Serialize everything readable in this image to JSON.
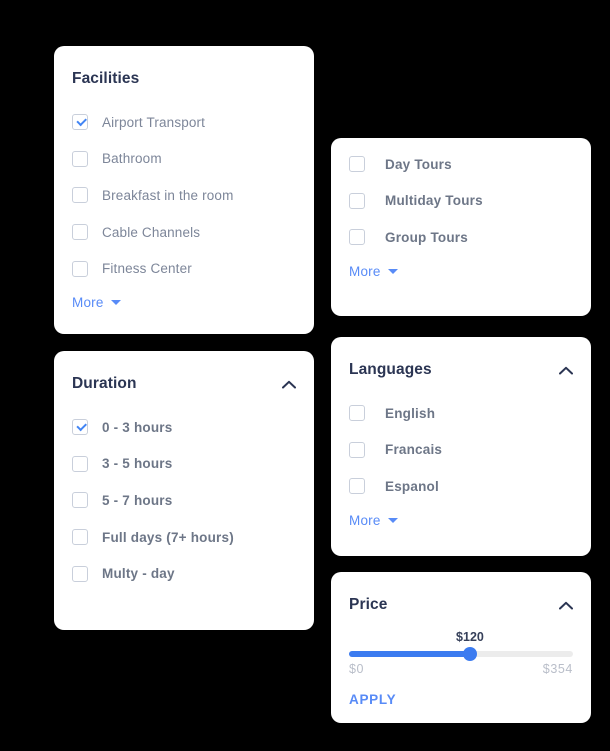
{
  "theme": {
    "page_background": "#000000",
    "card_background": "#ffffff",
    "title_color": "#2b3553",
    "label_color": "#7d8699",
    "accent_blue": "#588bf7",
    "slider_blue": "#3b7bf0",
    "checkbox_border": "#c9cfdb"
  },
  "cards": {
    "facilities": {
      "title": "Facilities",
      "options": [
        {
          "label": "Airport Transport",
          "checked": true
        },
        {
          "label": "Bathroom",
          "checked": false
        },
        {
          "label": "Breakfast in the room",
          "checked": false
        },
        {
          "label": "Cable Channels",
          "checked": false
        },
        {
          "label": "Fitness Center",
          "checked": false
        }
      ],
      "more_label": "More"
    },
    "tour_types": {
      "options": [
        {
          "label": "Day Tours",
          "checked": false
        },
        {
          "label": "Multiday Tours",
          "checked": false
        },
        {
          "label": "Group Tours",
          "checked": false
        }
      ],
      "more_label": "More"
    },
    "duration": {
      "title": "Duration",
      "options": [
        {
          "label": "0 - 3 hours",
          "checked": true
        },
        {
          "label": "3 - 5 hours",
          "checked": false
        },
        {
          "label": "5 - 7 hours",
          "checked": false
        },
        {
          "label": "Full days (7+ hours)",
          "checked": false
        },
        {
          "label": "Multy - day",
          "checked": false
        }
      ]
    },
    "languages": {
      "title": "Languages",
      "options": [
        {
          "label": "English",
          "checked": false
        },
        {
          "label": "Francais",
          "checked": false
        },
        {
          "label": "Espanol",
          "checked": false
        }
      ],
      "more_label": "More"
    },
    "price": {
      "title": "Price",
      "current_value": "$120",
      "min_label": "$0",
      "max_label": "$354",
      "min": 0,
      "max": 354,
      "value": 120,
      "fill_percent": 54,
      "apply_label": "APPLY"
    }
  },
  "icons": {
    "collapse": "chevron-up-icon",
    "more": "chevron-down-icon",
    "check": "check-icon"
  }
}
